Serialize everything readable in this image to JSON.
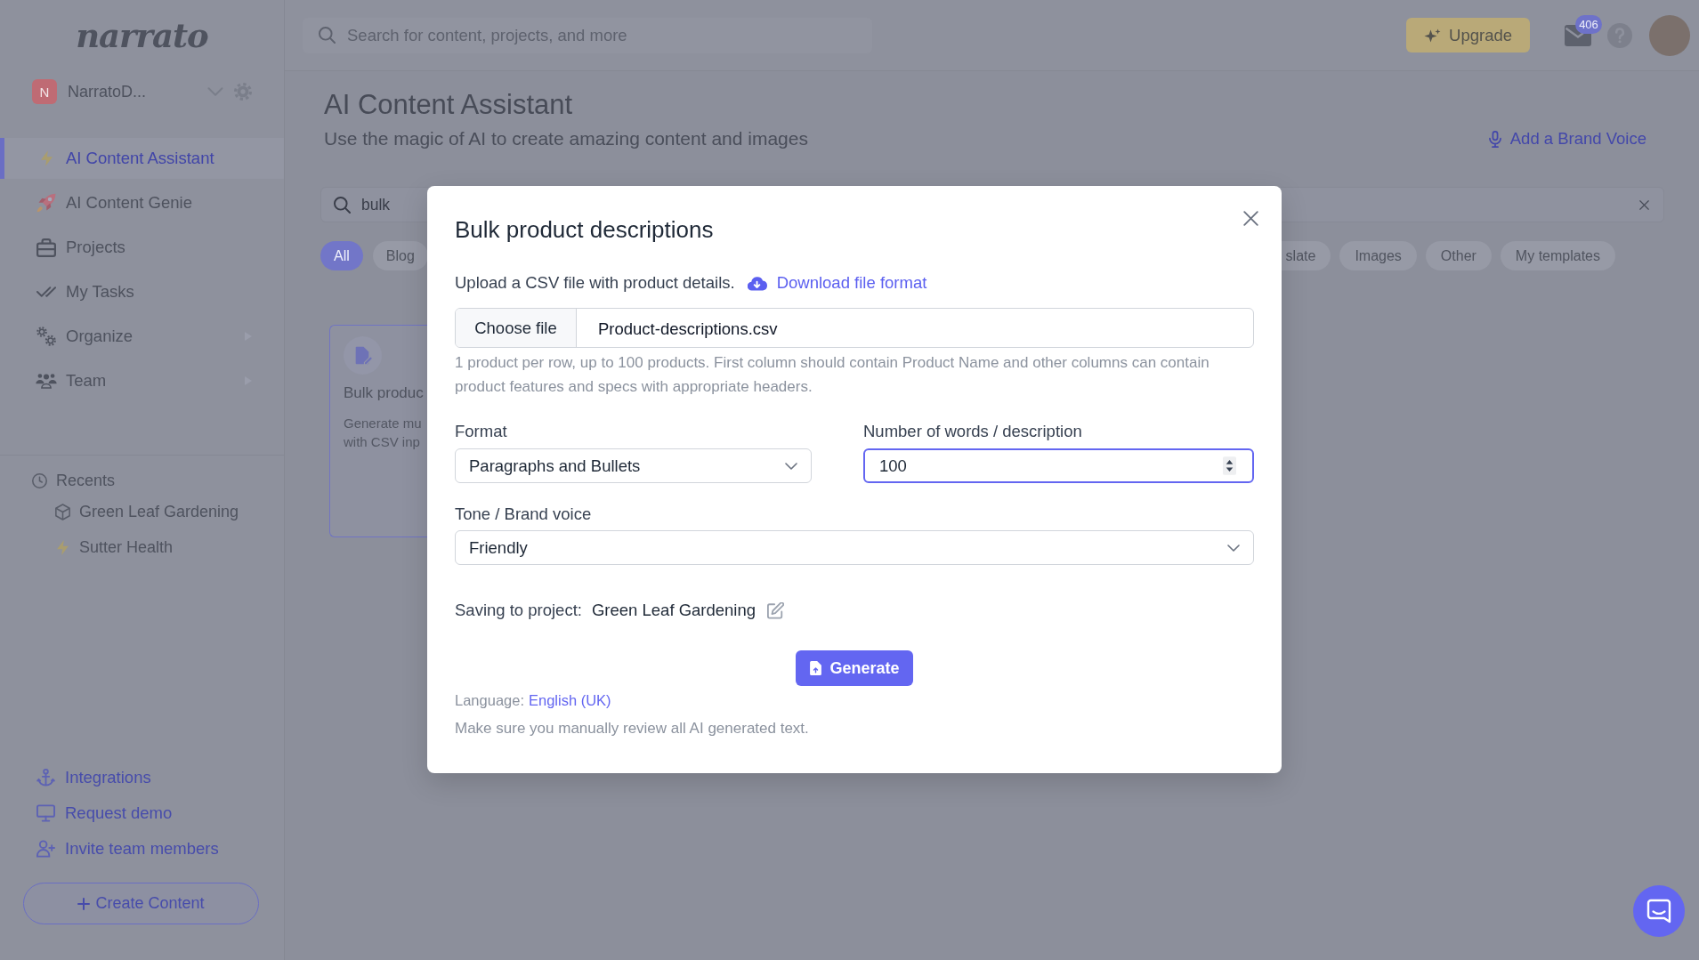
{
  "sidebar": {
    "logo": "narrato",
    "workspace": {
      "initial": "N",
      "name": "NarratoD..."
    },
    "nav": [
      {
        "label": "AI Content Assistant",
        "selected": true,
        "expandable": false
      },
      {
        "label": "AI Content Genie",
        "selected": false,
        "expandable": false
      },
      {
        "label": "Projects",
        "selected": false,
        "expandable": false
      },
      {
        "label": "My Tasks",
        "selected": false,
        "expandable": false
      },
      {
        "label": "Organize",
        "selected": false,
        "expandable": true
      },
      {
        "label": "Team",
        "selected": false,
        "expandable": true
      }
    ],
    "recents": {
      "title": "Recents",
      "items": [
        {
          "label": "Green Leaf Gardening",
          "kind": "project"
        },
        {
          "label": "Sutter Health",
          "kind": "assistant"
        }
      ]
    },
    "links": [
      {
        "label": "Integrations"
      },
      {
        "label": "Request demo"
      },
      {
        "label": "Invite team members"
      }
    ],
    "create_button": "Create Content"
  },
  "topbar": {
    "search": {
      "placeholder": "Search for content, projects, and more"
    },
    "upgrade_button": "Upgrade",
    "notification_count": "406"
  },
  "page": {
    "title": "AI Content Assistant",
    "subtitle": "Use the magic of AI to create amazing content and images",
    "brand_voice_link": "Add a Brand Voice",
    "search": {
      "value": "bulk"
    },
    "filters": [
      {
        "label": "All",
        "selected": true
      },
      {
        "label": "Blog",
        "selected": false
      },
      {
        "label": "slate",
        "selected": false
      },
      {
        "label": "Images",
        "selected": false
      },
      {
        "label": "Other",
        "selected": false
      },
      {
        "label": "My templates",
        "selected": false
      }
    ],
    "card": {
      "title": "Bulk produc",
      "description": "Generate mu with CSV inp"
    }
  },
  "modal": {
    "title": "Bulk product descriptions",
    "upload_label": "Upload a CSV file with product details.",
    "download_link": "Download file format",
    "file_button": "Choose file",
    "file_name": "Product-descriptions.csv",
    "hint": "1 product per row, up to 100 products. First column should contain Product Name and other columns can contain product features and specs with appropriate headers.",
    "format": {
      "label": "Format",
      "value": "Paragraphs and Bullets"
    },
    "word_count": {
      "label": "Number of words / description",
      "value": "100",
      "focused": true
    },
    "tone": {
      "label": "Tone / Brand voice",
      "value": "Friendly"
    },
    "project": {
      "label": "Saving to project:",
      "value": "Green Leaf Gardening"
    },
    "generate_button": "Generate",
    "language": {
      "label": "Language:",
      "value": "English (UK)"
    },
    "disclaimer": "Make sure you manually review all AI generated text."
  }
}
